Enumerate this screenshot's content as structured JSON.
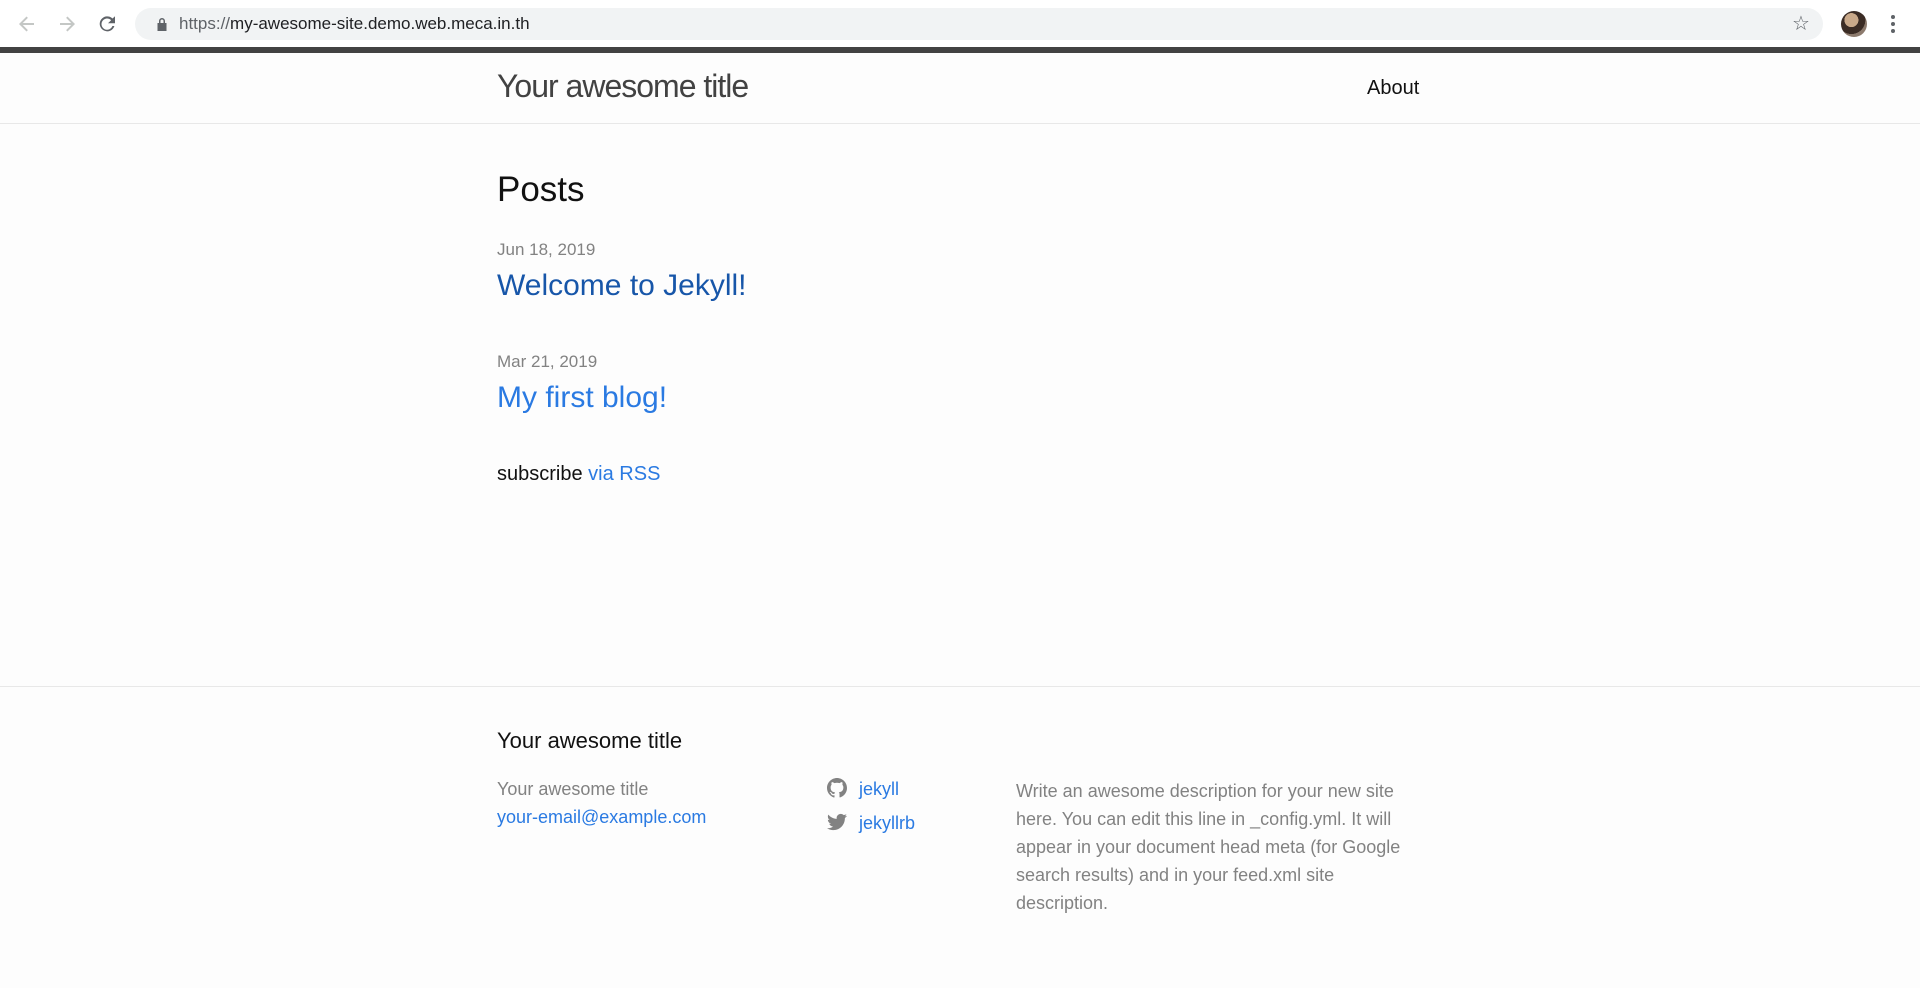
{
  "browser": {
    "url_scheme": "https://",
    "url_host": "my-awesome-site.demo.web.meca.in.th",
    "icons": [
      "back-arrow-icon",
      "forward-arrow-icon",
      "reload-icon",
      "lock-icon",
      "star-icon",
      "avatar",
      "more-menu-icon"
    ]
  },
  "header": {
    "site_title": "Your awesome title",
    "nav": [
      {
        "label": "About"
      }
    ]
  },
  "main": {
    "heading": "Posts",
    "posts": [
      {
        "date": "Jun 18, 2019",
        "title": "Welcome to Jekyll!"
      },
      {
        "date": "Mar 21, 2019",
        "title": "My first blog!"
      }
    ],
    "subscribe_prefix": "subscribe",
    "subscribe_link": "via RSS"
  },
  "footer": {
    "heading": "Your awesome title",
    "name": "Your awesome title",
    "email": "your-email@example.com",
    "social": [
      {
        "icon": "github-icon",
        "label": "jekyll"
      },
      {
        "icon": "twitter-icon",
        "label": "jekyllrb"
      }
    ],
    "description": "Write an awesome description for your new site here. You can edit this line in _config.yml. It will appear in your document head meta (for Google search results) and in your feed.xml site description."
  },
  "colors": {
    "link": "#2a7ae2",
    "visited_link": "#1756a9",
    "muted_text": "#828282",
    "header_rule": "#424242"
  }
}
